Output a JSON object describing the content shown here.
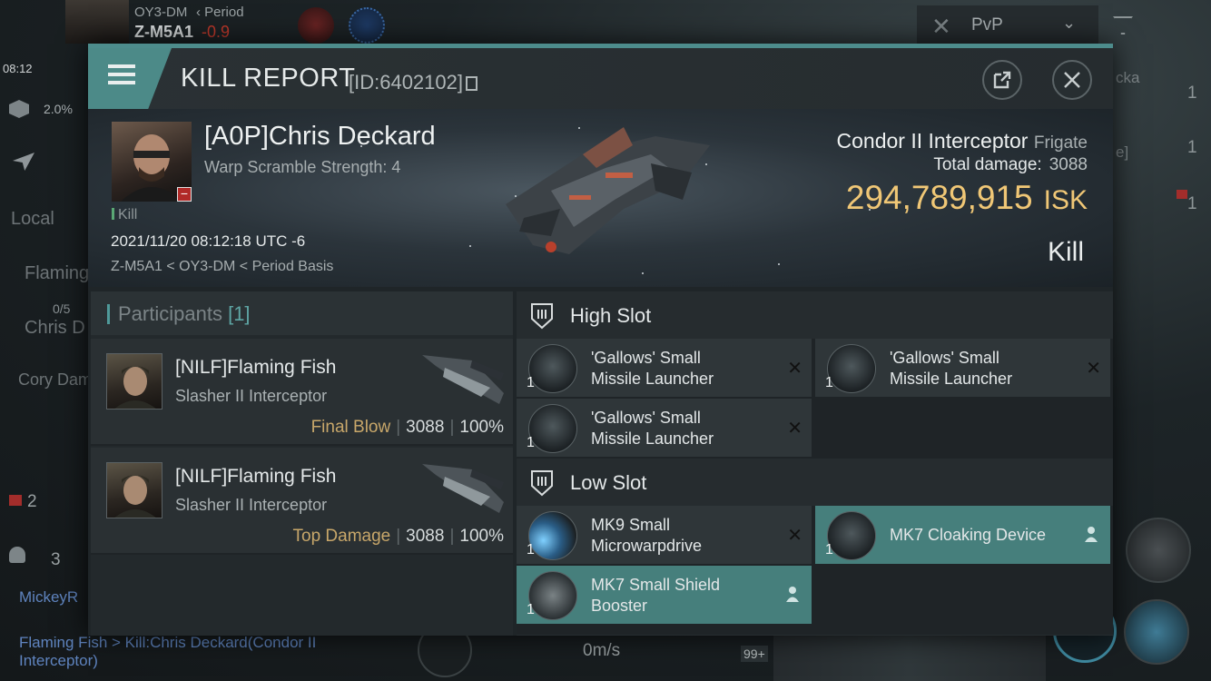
{
  "background": {
    "system_from": "OY3-DM",
    "period_label": "Period",
    "system_current": "Z-M5A1",
    "security": "-0.9",
    "time": "08:12",
    "cargo_pct": "2.0%",
    "local_label": "Local",
    "local_count": "2",
    "chat_names": [
      "Flaming",
      "Chris D",
      "Cory Dam"
    ],
    "counter_05": "0/5",
    "red_count": "2",
    "people_count": "3",
    "chat_user": "MickeyR",
    "chat_line1": "Flaming Fish > Kill:Chris Deckard(Condor II",
    "chat_line2": "Interceptor)",
    "pvp_label": "PvP",
    "speed": "0m/s",
    "badge": "99+",
    "right_counts": [
      "1",
      "1",
      "1"
    ],
    "right_text": [
      "cka",
      "e]"
    ]
  },
  "header": {
    "title": "KILL REPORT",
    "report_id": "[ID:6402102]"
  },
  "victim": {
    "name": "[A0P]Chris Deckard",
    "warp_scramble": "Warp Scramble Strength: 4",
    "tag": "Kill",
    "datetime": "2021/11/20 08:12:18 UTC -6",
    "location": "Z-M5A1 < OY3-DM < Period Basis",
    "ship": "Condor II Interceptor",
    "ship_class": "Frigate",
    "total_damage_label": "Total damage:",
    "total_damage": "3088",
    "isk_value": "294,789,915",
    "isk_unit": "ISK",
    "result": "Kill"
  },
  "participants": {
    "label": "Participants",
    "count": "[1]",
    "rows": [
      {
        "name": "[NILF]Flaming Fish",
        "ship": "Slasher II Interceptor",
        "role": "Final Blow",
        "damage": "3088",
        "percent": "100%"
      },
      {
        "name": "[NILF]Flaming Fish",
        "ship": "Slasher II Interceptor",
        "role": "Top Damage",
        "damage": "3088",
        "percent": "100%"
      }
    ]
  },
  "slots": {
    "high_label": "High Slot",
    "low_label": "Low Slot",
    "high": [
      {
        "qty": "1",
        "name1": "'Gallows' Small",
        "name2": "Missile Launcher",
        "state": "destroyed"
      },
      {
        "qty": "1",
        "name1": "'Gallows' Small",
        "name2": "Missile Launcher",
        "state": "destroyed"
      },
      {
        "qty": "1",
        "name1": "'Gallows' Small",
        "name2": "Missile Launcher",
        "state": "destroyed"
      }
    ],
    "low": [
      {
        "qty": "1",
        "name1": "MK9 Small",
        "name2": "Microwarpdrive",
        "state": "destroyed"
      },
      {
        "qty": "1",
        "name1": "MK7 Cloaking Device",
        "name2": "",
        "state": "dropped"
      },
      {
        "qty": "1",
        "name1": "MK7 Small Shield",
        "name2": "Booster",
        "state": "dropped"
      }
    ]
  },
  "colors": {
    "accent": "#4c8a88",
    "isk": "#f0c776",
    "fitted": "#467f7c",
    "final_blow": "#c8a76a"
  },
  "icons": [
    "menu-icon",
    "share-icon",
    "close-icon",
    "slot-icon",
    "user-icon",
    "destroyed-icon"
  ]
}
